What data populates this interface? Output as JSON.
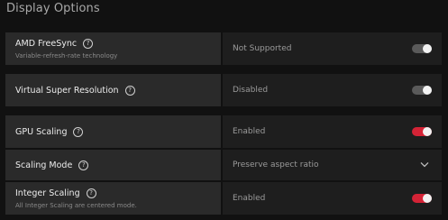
{
  "section": {
    "title": "Display Options"
  },
  "rows": [
    {
      "label": "AMD FreeSync",
      "description": "Variable-refresh-rate technology",
      "value": "Not Supported",
      "control": "toggle",
      "enabled": false
    },
    {
      "label": "Virtual Super Resolution",
      "description": "",
      "value": "Disabled",
      "control": "toggle",
      "enabled": false
    },
    {
      "label": "GPU Scaling",
      "description": "",
      "value": "Enabled",
      "control": "toggle",
      "enabled": true
    },
    {
      "label": "Scaling Mode",
      "description": "",
      "value": "Preserve aspect ratio",
      "control": "dropdown"
    },
    {
      "label": "Integer Scaling",
      "description": "All Integer Scaling are centered mode.",
      "value": "Enabled",
      "control": "toggle",
      "enabled": true
    }
  ],
  "icons": {
    "help": "?",
    "toggle": "toggle-switch-icon",
    "dropdown": "chevron-down-icon"
  },
  "colors": {
    "accent": "#d42336",
    "toggle_off": "#5a5a5a",
    "panel_left": "#2a2a2a",
    "panel_right": "#1e1e1e",
    "background": "#111111"
  }
}
